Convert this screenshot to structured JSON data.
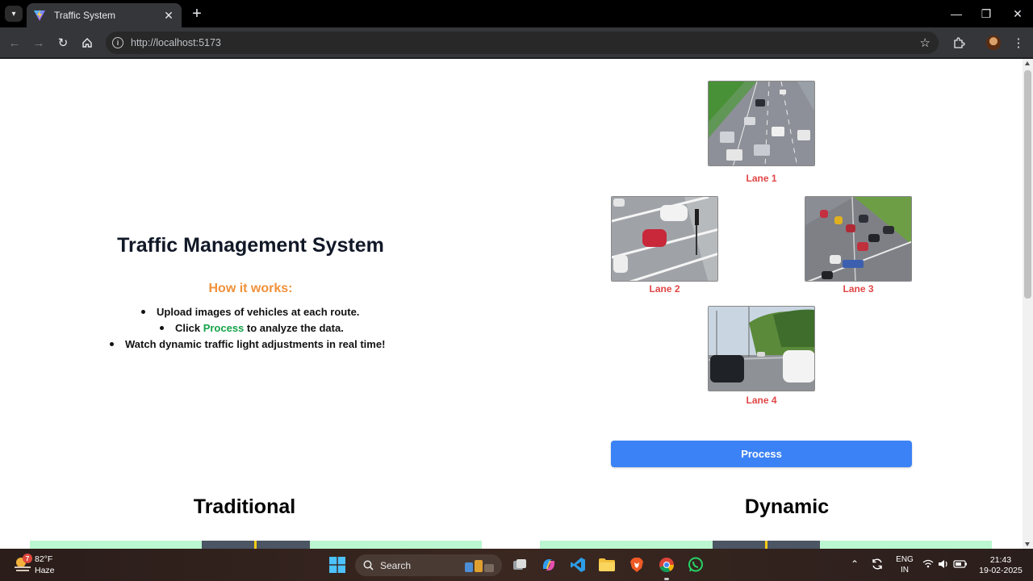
{
  "browser": {
    "tab_title": "Traffic System",
    "url": "http://localhost:5173"
  },
  "page": {
    "title": "Traffic Management System",
    "how_heading": "How it works:",
    "steps": {
      "step1": "Upload images of vehicles at each route.",
      "step2_prefix": "Click ",
      "step2_highlight": "Process",
      "step2_suffix": " to analyze the data.",
      "step3": "Watch dynamic traffic light adjustments in real time!"
    },
    "lanes": [
      "Lane 1",
      "Lane 2",
      "Lane 3",
      "Lane 4"
    ],
    "process_button": "Process",
    "sections": {
      "traditional": "Traditional",
      "dynamic": "Dynamic"
    },
    "colors": {
      "title": "#111827",
      "how_heading": "#f0913a",
      "process_word": "#16a34a",
      "lane_label": "#e04646",
      "process_button": "#3b82f6"
    }
  },
  "taskbar": {
    "weather_badge": "7",
    "temperature": "82°F",
    "condition": "Haze",
    "search_label": "Search",
    "lang_top": "ENG",
    "lang_bottom": "IN",
    "time": "21:43",
    "date": "19-02-2025"
  }
}
